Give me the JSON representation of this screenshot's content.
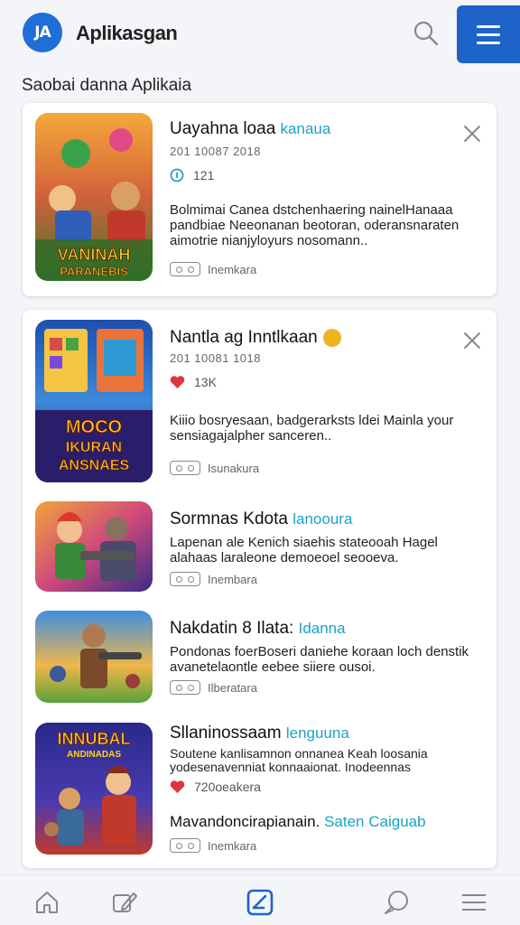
{
  "header": {
    "logo_text": "JA",
    "title": "Aplikasgan",
    "search_icon": "search-icon",
    "menu_icon": "hamburger-icon",
    "accent": "#1d63c9"
  },
  "section": {
    "title": "Saobai danna  Aplikaia"
  },
  "items": [
    {
      "title": "Uayahna loaa",
      "tag": "kanaua",
      "meta": "201 10087 2018",
      "stat_icon": "info-icon",
      "stat": "121",
      "desc": "Bolmimai Canea dstchenhaering nainelHanaaa pandbiae Neeonanan beotoran, oderansnaraten aimotrie nianjyloyurs nosomann..",
      "foot": "Inemkara",
      "thumb_text": "VANINAH PARANEBIS"
    },
    {
      "title": "Nantla ag Inntlkaan",
      "meta": "201 10081 1018",
      "stat_icon": "heart-icon",
      "stat": "13K",
      "desc": "Kiiio bosryesaan, badgerarksts ldei Mainla your sensiagajalpher sanceren..",
      "foot": "Isunakura",
      "thumb_text": "MOCO IKURAN ANSNAES"
    },
    {
      "title": "Sormnas Kdota",
      "tag": "lanooura",
      "desc": "Lapenan ale Kenich siaehis stateooah Hagel alahaas laraleone demoeoel seooeva.",
      "foot": "Inembara",
      "thumb_text": ""
    },
    {
      "title": "Nakdatin 8 Ilata:",
      "tag": "Idanna",
      "desc": "Pondonas foerBoseri daniehe koraan loch denstik avanetelaontle eebee siiere ousoi.",
      "foot": "Ilberatara",
      "thumb_text": ""
    },
    {
      "title": "Sllaninossaam",
      "tag": "lenguuna",
      "desc": "Soutene kanlisamnon onnanea Keah loosania yodesenavenniat konnaaionat. Inodeennas",
      "stat_icon": "heart-icon",
      "stat": "720oeakera",
      "sub": "Mavandoncirapianain.",
      "sub_tag": "Saten Caiguab",
      "foot": "Inemkara",
      "thumb_text": "INNUBAL ANDINADAS"
    }
  ],
  "bottom_nav": [
    {
      "name": "home-icon",
      "active": false
    },
    {
      "name": "edit-icon",
      "active": false
    },
    {
      "name": "check-icon",
      "active": true
    },
    {
      "name": "chat-icon",
      "active": false
    },
    {
      "name": "list-icon",
      "active": false
    }
  ]
}
